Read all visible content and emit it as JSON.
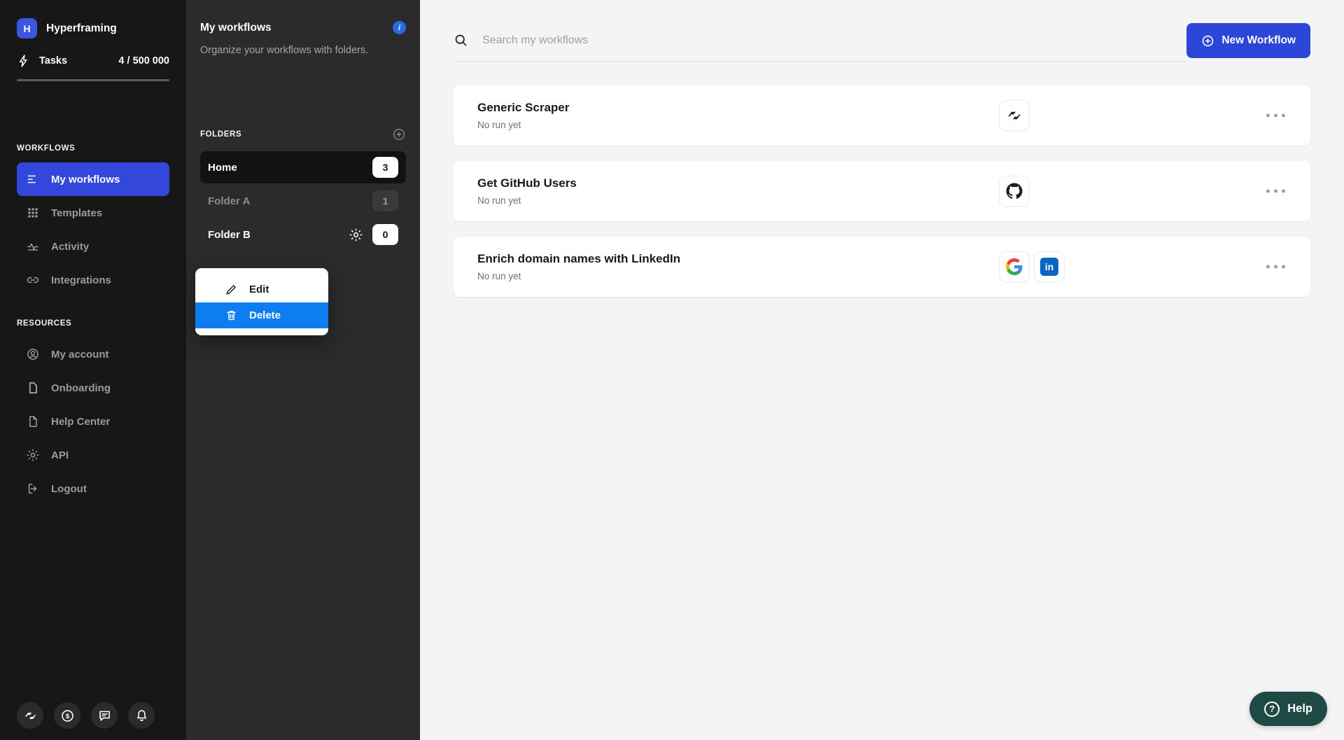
{
  "brand": {
    "initial": "H",
    "name": "Hyperframing",
    "tasks_label": "Tasks",
    "tasks_value": "4 / 500 000"
  },
  "sidebar": {
    "sections": [
      {
        "label": "WORKFLOWS",
        "items": [
          {
            "label": "My workflows",
            "icon": "list-icon",
            "active": true
          },
          {
            "label": "Templates",
            "icon": "grid-icon"
          },
          {
            "label": "Activity",
            "icon": "activity-icon"
          },
          {
            "label": "Integrations",
            "icon": "link-icon"
          }
        ]
      },
      {
        "label": "RESOURCES",
        "items": [
          {
            "label": "My account",
            "icon": "user-icon"
          },
          {
            "label": "Onboarding",
            "icon": "document-icon"
          },
          {
            "label": "Help Center",
            "icon": "file-icon"
          },
          {
            "label": "API",
            "icon": "gear-icon"
          },
          {
            "label": "Logout",
            "icon": "logout-icon"
          }
        ]
      }
    ],
    "footer_icons": [
      "brand-glyph-icon",
      "currency-icon",
      "chat-icon",
      "bell-icon"
    ]
  },
  "folders_panel": {
    "title": "My workflows",
    "description": "Organize your workflows with folders.",
    "section_label": "FOLDERS",
    "folders": [
      {
        "name": "Home",
        "count": "3",
        "state": "active"
      },
      {
        "name": "Folder A",
        "count": "1",
        "state": "default"
      },
      {
        "name": "Folder B",
        "count": "0",
        "state": "hover"
      }
    ],
    "context_menu": {
      "edit_label": "Edit",
      "delete_label": "Delete"
    }
  },
  "main": {
    "search_placeholder": "Search my workflows",
    "new_workflow_label": "New Workflow",
    "workflows": [
      {
        "title": "Generic Scraper",
        "status": "No run yet",
        "integrations": [
          "hyperframing"
        ]
      },
      {
        "title": "Get GitHub Users",
        "status": "No run yet",
        "integrations": [
          "github"
        ]
      },
      {
        "title": "Enrich domain names with LinkedIn",
        "status": "No run yet",
        "integrations": [
          "google",
          "linkedin"
        ]
      }
    ],
    "linkedin_glyph": "in",
    "help_label": "Help"
  },
  "colors": {
    "accent": "#3347DB",
    "button": "#2C46D8",
    "logo": "#3B55E5",
    "info": "#2A6BE2",
    "delete": "#0D7EF2",
    "linkedin": "#0A66C2",
    "help": "#1E4A46",
    "google_blue": "#4285F4",
    "google_green": "#34A853",
    "google_yellow": "#FBBC05",
    "google_red": "#EA4335"
  }
}
